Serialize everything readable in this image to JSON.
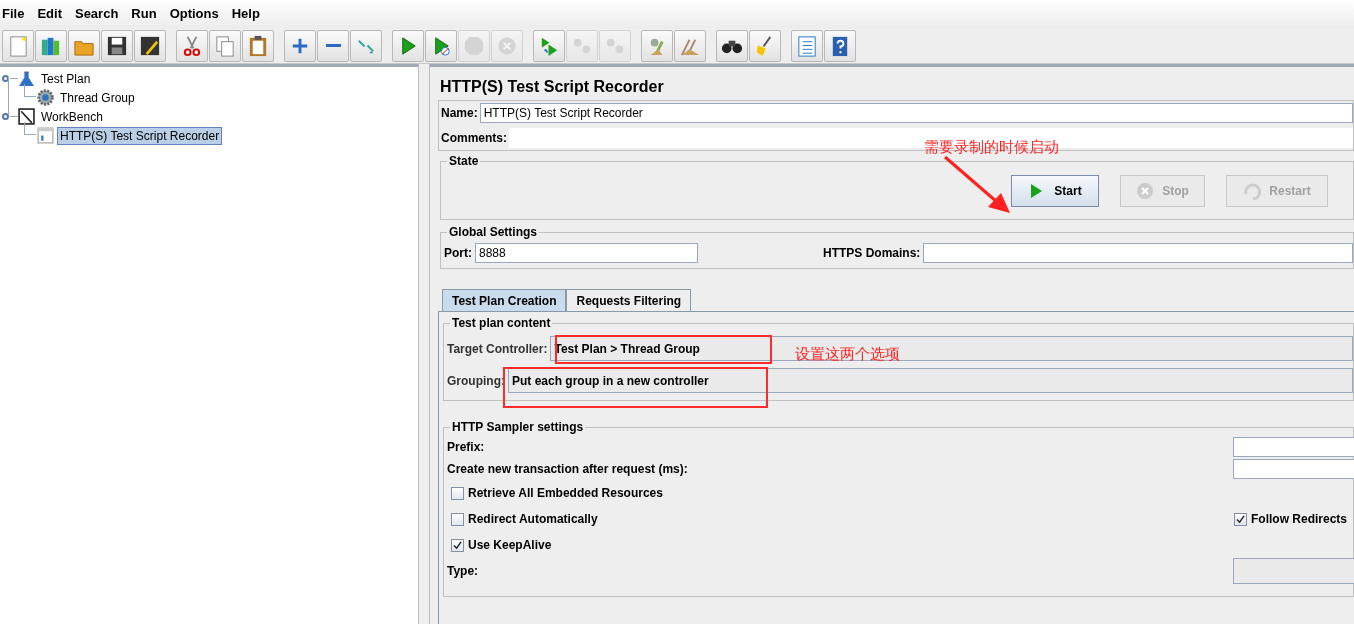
{
  "menu": [
    {
      "label": "File"
    },
    {
      "label": "Edit"
    },
    {
      "label": "Search"
    },
    {
      "label": "Run"
    },
    {
      "label": "Options"
    },
    {
      "label": "Help"
    }
  ],
  "toolbar": [
    [
      {
        "kind": "new",
        "disabled": false
      },
      {
        "kind": "templates",
        "disabled": false
      },
      {
        "kind": "open",
        "disabled": false
      },
      {
        "kind": "save",
        "disabled": false
      },
      {
        "kind": "save_as",
        "disabled": false
      }
    ],
    [
      {
        "kind": "cut",
        "disabled": false
      },
      {
        "kind": "copy",
        "disabled": false
      },
      {
        "kind": "paste",
        "disabled": false
      }
    ],
    [
      {
        "kind": "expand",
        "disabled": false
      },
      {
        "kind": "collapse",
        "disabled": false
      },
      {
        "kind": "toggle",
        "disabled": false
      }
    ],
    [
      {
        "kind": "start",
        "disabled": false
      },
      {
        "kind": "start_no_pause",
        "disabled": false
      },
      {
        "kind": "stop",
        "disabled": true
      },
      {
        "kind": "shutdown",
        "disabled": true
      }
    ],
    [
      {
        "kind": "remote_start",
        "disabled": false
      },
      {
        "kind": "remote_stop",
        "disabled": true
      },
      {
        "kind": "remote_exit",
        "disabled": true
      }
    ],
    [
      {
        "kind": "clear",
        "disabled": false
      },
      {
        "kind": "clear_all",
        "disabled": false
      }
    ],
    [
      {
        "kind": "search",
        "disabled": false
      },
      {
        "kind": "reset_search",
        "disabled": false
      }
    ],
    [
      {
        "kind": "function",
        "disabled": false
      },
      {
        "kind": "help",
        "disabled": false
      }
    ]
  ],
  "tree": [
    {
      "label": "Test Plan",
      "kind": "plan",
      "selected": false,
      "children": [
        {
          "label": "Thread Group",
          "kind": "gear",
          "selected": false
        }
      ]
    },
    {
      "label": "WorkBench",
      "kind": "bench",
      "selected": false,
      "children": [
        {
          "label": "HTTP(S) Test Script Recorder",
          "kind": "recorder",
          "selected": true
        }
      ]
    }
  ],
  "panel": {
    "title": "HTTP(S) Test Script Recorder",
    "name": {
      "label": "Name:",
      "value": "HTTP(S) Test Script Recorder"
    },
    "comments": {
      "label": "Comments:"
    },
    "state": {
      "title": "State",
      "buttons": [
        {
          "label": "Start",
          "kind": "start",
          "disabled": false
        },
        {
          "label": "Stop",
          "kind": "stop",
          "disabled": true
        },
        {
          "label": "Restart",
          "kind": "restart",
          "disabled": true
        }
      ]
    },
    "global_settings": {
      "title": "Global Settings",
      "port": {
        "label": "Port:",
        "value": "8888"
      },
      "https_domains": {
        "label": "HTTPS Domains:"
      }
    },
    "tabs": [
      {
        "label": "Test Plan Creation",
        "selected": true
      },
      {
        "label": "Requests Filtering",
        "selected": false
      }
    ],
    "test_plan_content": {
      "title": "Test plan content",
      "target_controller": {
        "label": "Target Controller:",
        "value": "Test Plan > Thread Group"
      },
      "grouping": {
        "label": "Grouping:",
        "value": "Put each group in a new controller"
      }
    },
    "sampler": {
      "title": "HTTP Sampler settings",
      "prefix": {
        "label": "Prefix:"
      },
      "transaction": {
        "label": "Create new transaction after request (ms):"
      },
      "checkboxes": [
        {
          "label": "Retrieve All Embedded Resources",
          "checked": false
        },
        {
          "label": "Redirect Automatically",
          "checked": false
        },
        {
          "label": "Follow Redirects",
          "checked": true
        },
        {
          "label": "Use KeepAlive",
          "checked": true
        }
      ],
      "type": {
        "label": "Type:"
      }
    }
  },
  "annotations": [
    {
      "kind": "note",
      "text": "需要录制的时候启动"
    },
    {
      "kind": "arrow"
    },
    {
      "kind": "box"
    },
    {
      "kind": "box"
    },
    {
      "kind": "note",
      "text": "设置这两个选项"
    }
  ]
}
